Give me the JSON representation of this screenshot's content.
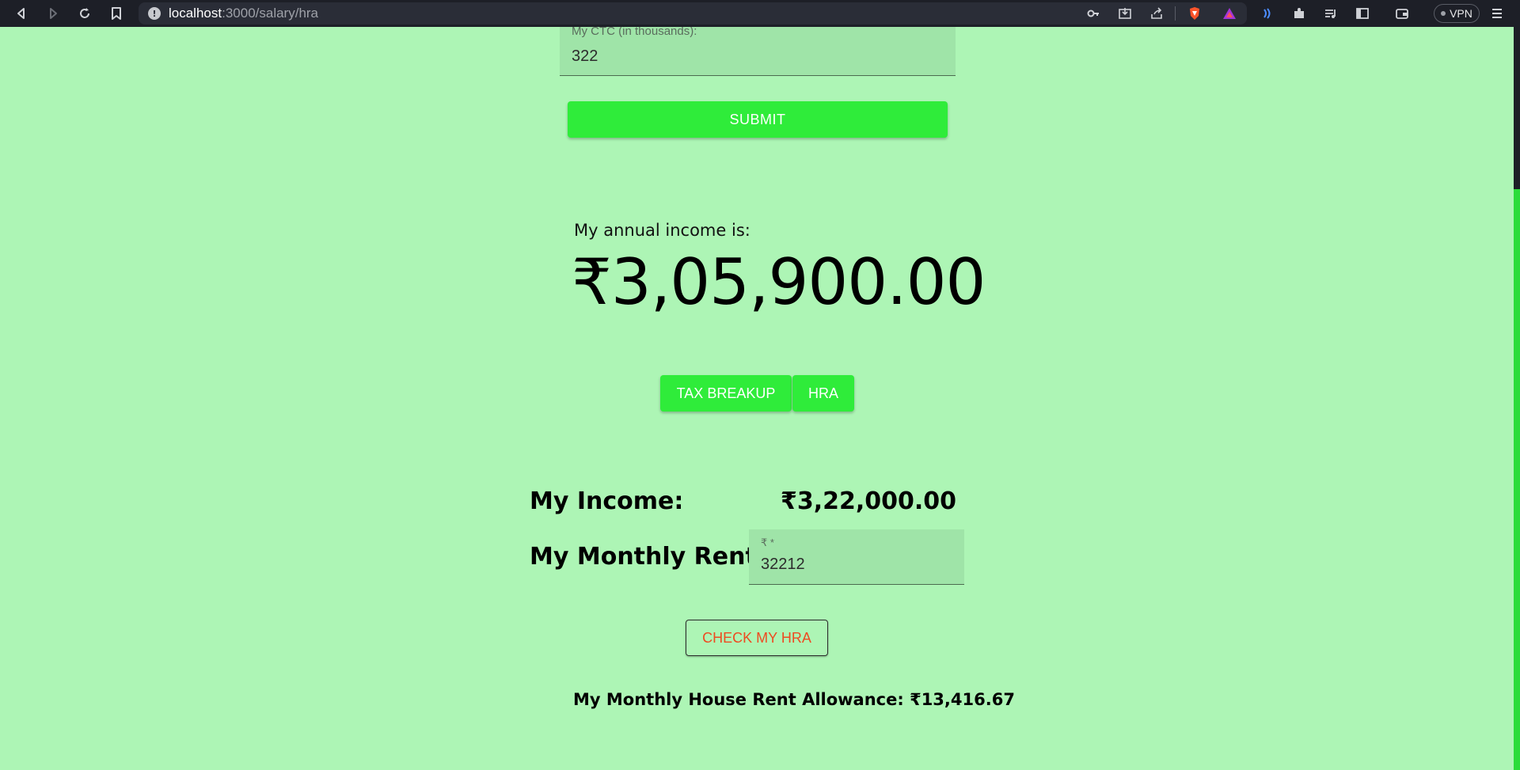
{
  "browser": {
    "url_host": "localhost",
    "url_path": ":3000/salary/hra",
    "vpn_label": "VPN"
  },
  "form": {
    "ctc_label": "My CTC (in thousands):",
    "ctc_value": "322",
    "submit_label": "SUBMIT"
  },
  "summary": {
    "annual_label": "My annual income is:",
    "annual_value": "₹3,05,900.00"
  },
  "tabs": [
    {
      "label": "TAX BREAKUP"
    },
    {
      "label": "HRA"
    }
  ],
  "hra": {
    "income_label": "My Income:",
    "income_value": "₹3,22,000.00",
    "rent_label": "My Monthly Rent:",
    "rent_prefix": "₹ *",
    "rent_value": "32212",
    "check_label": "CHECK MY HRA",
    "result_text": "My Monthly House Rent Allowance: ₹13,416.67"
  },
  "colors": {
    "page_background": "#adf5b5",
    "button_green": "#2fec3a",
    "check_text": "#ee4a21"
  }
}
